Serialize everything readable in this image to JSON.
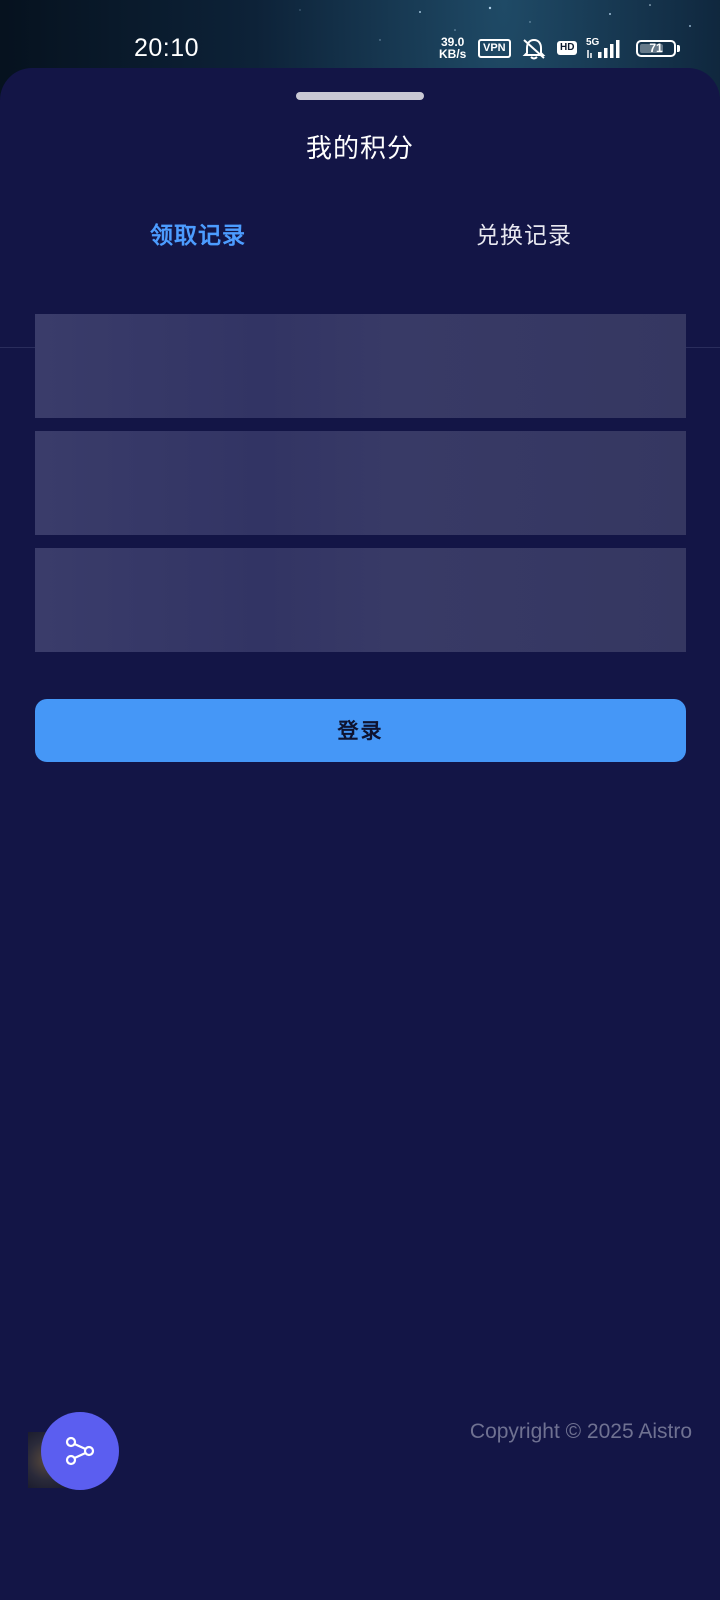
{
  "status_bar": {
    "time": "20:10",
    "net_speed_value": "39.0",
    "net_speed_unit": "KB/s",
    "vpn_label": "VPN",
    "hd_label": "HD",
    "network_type": "5G",
    "battery_level": "71",
    "icons": [
      "mute-bell-icon",
      "signal-bars-icon",
      "battery-icon"
    ]
  },
  "sheet": {
    "title": "我的积分",
    "tabs": [
      {
        "label": "领取记录",
        "active": true
      },
      {
        "label": "兑换记录",
        "active": false
      }
    ],
    "login_button_label": "登录"
  },
  "footer": {
    "copyright": "Copyright © 2025 Aistro",
    "share_icon": "share-icon"
  },
  "colors": {
    "sheet_background": "#131546",
    "accent_blue": "#4597f7",
    "fab_purple": "#5b5ef0",
    "skeleton": "#363866"
  }
}
